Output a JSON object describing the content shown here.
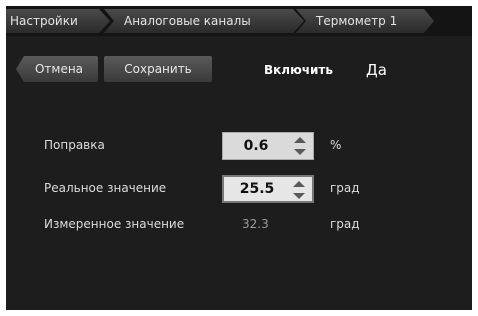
{
  "breadcrumb": [
    "Настройки",
    "Аналоговые каналы",
    "Термометр 1"
  ],
  "toolbar": {
    "cancel_label": "Отмена",
    "save_label": "Сохранить"
  },
  "enable": {
    "label": "Включить",
    "value": "Да"
  },
  "fields": {
    "correction": {
      "label": "Поправка",
      "value": "0.6",
      "unit": "%"
    },
    "real_value": {
      "label": "Реальное значение",
      "value": "25.5",
      "unit": "град"
    },
    "measured_value": {
      "label": "Измеренное значение",
      "value": "32.3",
      "unit": "град"
    }
  },
  "colors": {
    "background": "#1d1d1d",
    "button": "#4a4a4a",
    "spin_field": "#dadada"
  },
  "icons": {
    "spinner": "up-down-arrows-icon"
  }
}
